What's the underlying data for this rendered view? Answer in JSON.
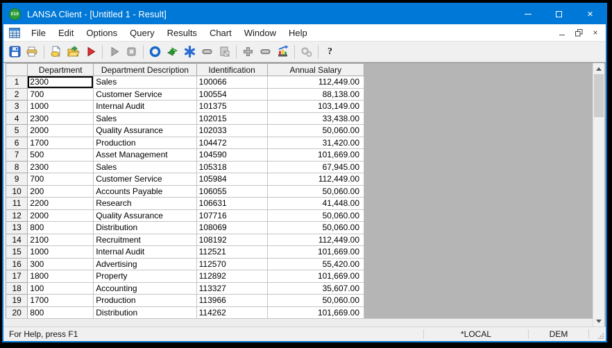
{
  "window": {
    "title": "LANSA Client - [Untitled 1 - Result]",
    "app_icon_label": "010",
    "controls": [
      "minimize",
      "maximize",
      "close"
    ]
  },
  "menu_bar": {
    "items": [
      "File",
      "Edit",
      "Options",
      "Query",
      "Results",
      "Chart",
      "Window",
      "Help"
    ],
    "mdi_controls": [
      "minimize",
      "restore",
      "close"
    ]
  },
  "toolbar": {
    "icons": [
      "save",
      "print",
      "new-query-document",
      "open-folder",
      "run-red",
      "run-gray",
      "stop",
      "record-circle",
      "swap-arrows",
      "asterisk",
      "wide-minus",
      "export-document",
      "add-plus",
      "remove-minus",
      "chart",
      "settings-gears",
      "help"
    ],
    "help_label": "?"
  },
  "grid": {
    "columns": [
      "",
      "Department",
      "Department Description",
      "Identification",
      "Annual Salary"
    ],
    "selected_cell": {
      "row": 1,
      "column": "Department",
      "value": "2300"
    },
    "rows": [
      [
        "1",
        "2300",
        "Sales",
        "100066",
        "112,449.00"
      ],
      [
        "2",
        "700",
        "Customer Service",
        "100554",
        "88,138.00"
      ],
      [
        "3",
        "1000",
        "Internal Audit",
        "101375",
        "103,149.00"
      ],
      [
        "4",
        "2300",
        "Sales",
        "102015",
        "33,438.00"
      ],
      [
        "5",
        "2000",
        "Quality Assurance",
        "102033",
        "50,060.00"
      ],
      [
        "6",
        "1700",
        "Production",
        "104472",
        "31,420.00"
      ],
      [
        "7",
        "500",
        "Asset Management",
        "104590",
        "101,669.00"
      ],
      [
        "8",
        "2300",
        "Sales",
        "105318",
        "67,945.00"
      ],
      [
        "9",
        "700",
        "Customer Service",
        "105984",
        "112,449.00"
      ],
      [
        "10",
        "200",
        "Accounts Payable",
        "106055",
        "50,060.00"
      ],
      [
        "11",
        "2200",
        "Research",
        "106631",
        "41,448.00"
      ],
      [
        "12",
        "2000",
        "Quality Assurance",
        "107716",
        "50,060.00"
      ],
      [
        "13",
        "800",
        "Distribution",
        "108069",
        "50,060.00"
      ],
      [
        "14",
        "2100",
        "Recruitment",
        "108192",
        "112,449.00"
      ],
      [
        "15",
        "1000",
        "Internal Audit",
        "112521",
        "101,669.00"
      ],
      [
        "16",
        "300",
        "Advertising",
        "112570",
        "55,420.00"
      ],
      [
        "17",
        "1800",
        "Property",
        "112892",
        "101,669.00"
      ],
      [
        "18",
        "100",
        "Accounting",
        "113327",
        "35,607.00"
      ],
      [
        "19",
        "1700",
        "Production",
        "113966",
        "50,060.00"
      ],
      [
        "20",
        "800",
        "Distribution",
        "114262",
        "101,669.00"
      ]
    ]
  },
  "status_bar": {
    "message": "For Help, press F1",
    "partition": "*LOCAL",
    "environment": "DEM"
  },
  "colors": {
    "title_bar": "#0078d7",
    "window_border": "#0078d7",
    "grid_empty_area": "#b5b5b5",
    "chrome_background": "#f0f0f0",
    "selection_border": "#000000"
  }
}
